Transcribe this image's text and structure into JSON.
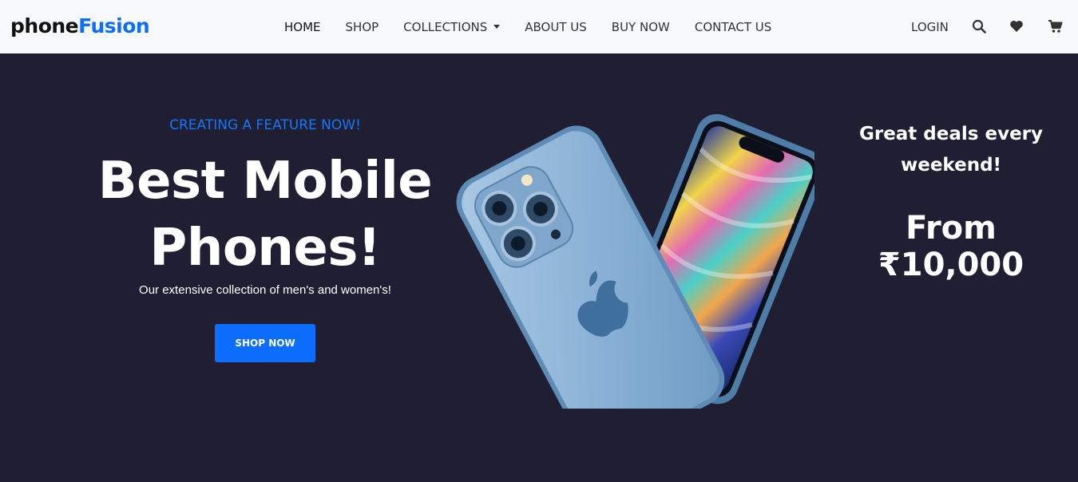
{
  "brand": {
    "part1": "phone",
    "part2": "Fusion"
  },
  "nav": {
    "items": [
      {
        "label": "HOME"
      },
      {
        "label": "SHOP"
      },
      {
        "label": "COLLECTIONS"
      },
      {
        "label": "ABOUT US"
      },
      {
        "label": "BUY NOW"
      },
      {
        "label": "CONTACT US"
      }
    ],
    "login": "LOGIN",
    "icons": [
      "search-icon",
      "heart-icon",
      "cart-icon"
    ]
  },
  "hero": {
    "eyebrow": "CREATING A FEATURE NOW!",
    "headline_line1": "Best Mobile",
    "headline_line2": "Phones!",
    "subtext": "Our extensive collection of men's and women's!",
    "button": "SHOP NOW",
    "deals_line1": "Great deals every",
    "deals_line2": "weekend!",
    "price": "From ₹10,000"
  },
  "colors": {
    "accent": "#0d6efd",
    "hero_background": "#1f1e33",
    "navbar_background": "#f8f9fa",
    "phone_body": "#8fb4d6"
  }
}
